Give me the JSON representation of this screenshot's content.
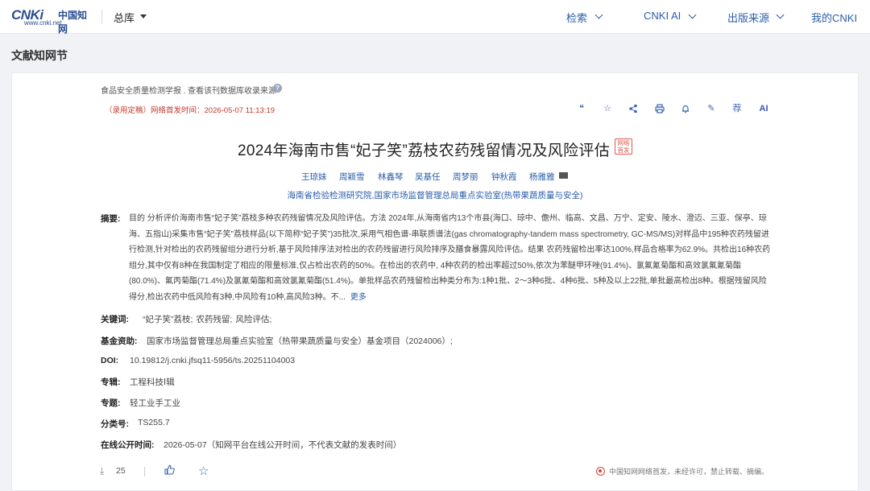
{
  "header": {
    "logo_mark": "CNKi",
    "logo_cn": "中国知网",
    "logo_url": "www.cnki.net",
    "library": "总库",
    "nav": [
      "检索",
      "CNKI AI",
      "出版来源",
      "我的CNKI"
    ]
  },
  "section_title": "文献知网节",
  "article": {
    "breadcrumb": "食品安全质量检测学报 .",
    "breadcrumb_link": "查看该刊数据库收录来源",
    "pub_status": "（录用定稿）网络首发时间：2026-05-07 11:13:19",
    "toolbar_icons": [
      "quote-icon",
      "star-outline-icon",
      "share-icon",
      "print-icon",
      "bell-icon",
      "pen-icon",
      "recommend-icon",
      "ai-icon"
    ],
    "toolbar_recommend": "荐",
    "toolbar_ai": "AI",
    "title": "2024年海南市售“妃子笑”荔枝农药残留情况及风险评估",
    "title_badge": "网络首发",
    "authors": [
      "王琼妹",
      "周颖雪",
      "林鑫琴",
      "吴基任",
      "周梦丽",
      "钟秋霞",
      "杨雅雅"
    ],
    "affiliation": "海南省检验检测研究院,国家市场监督管理总局重点实验室(热带果蔬质量与安全)",
    "abstract_label": "摘要:",
    "abstract": "目的 分析评价海南市售“妃子笑”荔枝多种农药残留情况及风险评估。方法 2024年,从海南省内13个市县(海口、琼中、儋州、临高、文昌、万宁、定安、陵水、澄迈、三亚、保亭、琼海、五指山)采集市售“妃子笑”荔枝样品(以下简称“妃子笑”)35批次,采用气相色谱-串联质谱法(gas chromatography-tandem mass spectrometry, GC-MS/MS)对样品中195种农药残留进行检测,针对检出的农药残留组分进行分析,基于风险排序法对检出的农药残留进行风险排序及膳食暴露风险评估。结果 农药残留检出率达100%,样品合格率为62.9%。共检出16种农药组分,其中仅有8种在我国制定了相应的限量标准,仅占检出农药的50%。在检出的农药中, 4种农药的检出率超过50%,依次为苯醚甲环唑(91.4%)、氯氟氰菊酯和高效氯氟氰菊酯(80.0%)、氟丙菊酯(71.4%)及氯氰菊酯和高效氯氰菊酯(51.4%)。单批样品农药残留检出种类分布为:1种1批、2～3种6批、4种6批、5种及以上22批,单批最高检出8种。根据残留风险得分,检出农药中低风险有3种,中风险有10种,高风险3种。不...",
    "more": "更多",
    "keywords_label": "关键词:",
    "keywords": [
      "“妃子笑”荔枝;",
      "农药残留;",
      "风险评估;"
    ],
    "fund_label": "基金资助:",
    "fund": "国家市场监督管理总局重点实验室（热带果蔬质量与安全）基金项目（2024006）;",
    "doi_label": "DOI:",
    "doi": "10.19812/j.cnki.jfsq11-5956/ts.20251104003",
    "series_label": "专辑:",
    "series": "工程科技Ⅰ辑",
    "topic_label": "专题:",
    "topic": "轻工业手工业",
    "class_label": "分类号:",
    "class_no": "TS255.7",
    "online_label": "在线公开时间:",
    "online_time": "2026-05-07（知网平台在线公开时间，不代表文献的发表时间）",
    "downloads": "25",
    "copyright": "中国知网网络首发，未经许可，禁止转载、摘编。"
  }
}
